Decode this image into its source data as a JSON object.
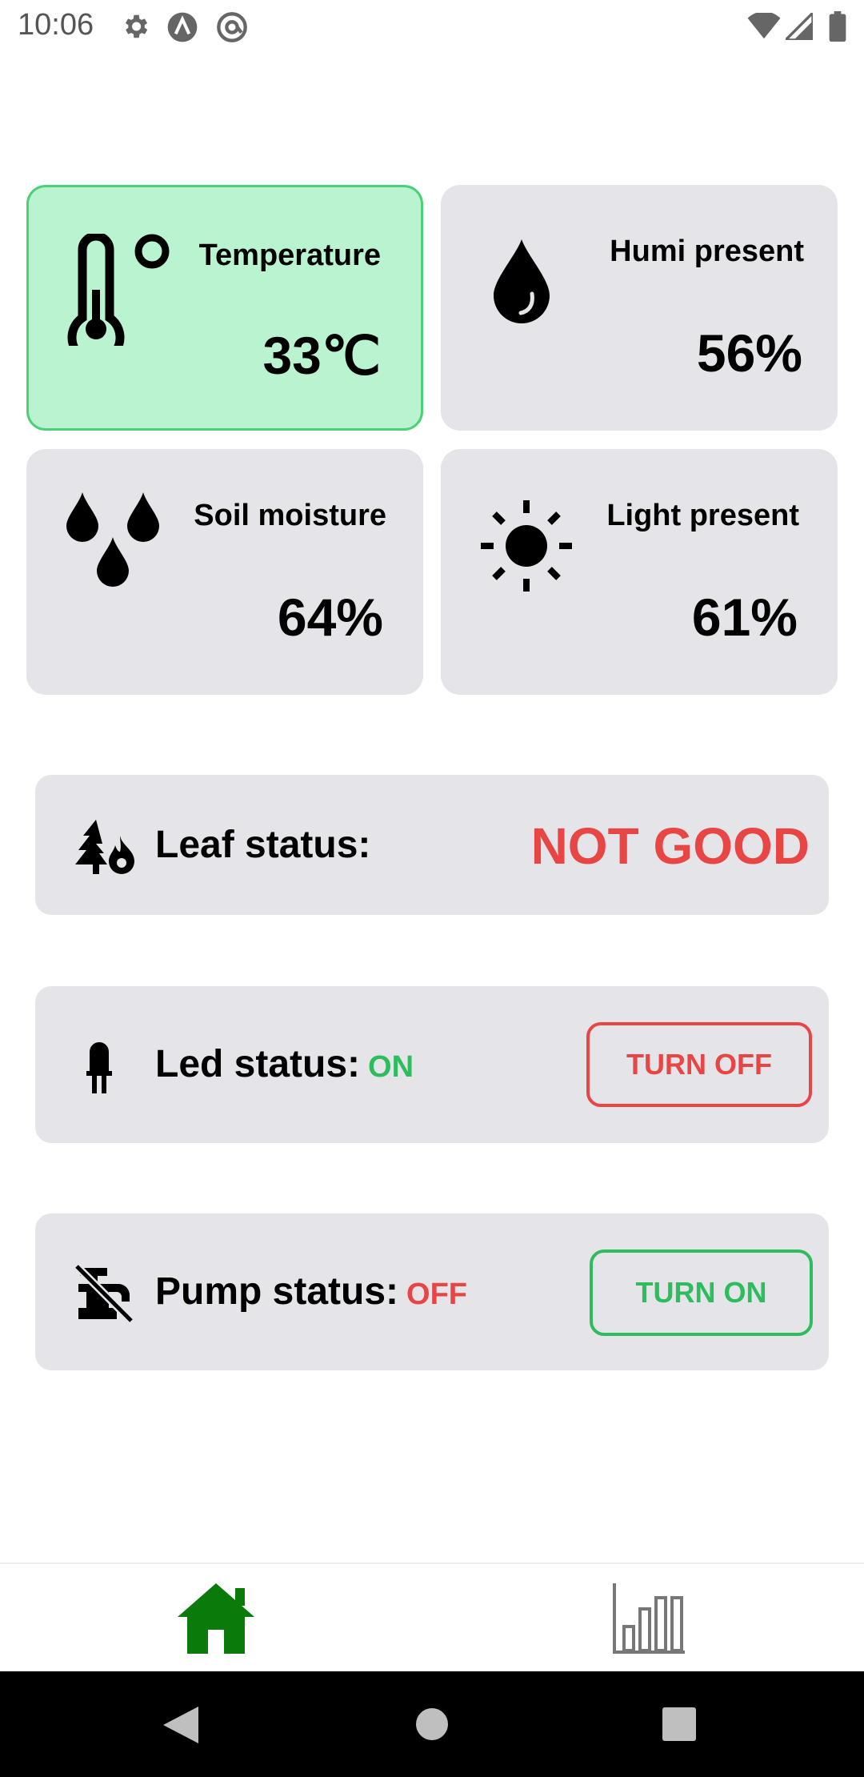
{
  "status_bar": {
    "time": "10:06",
    "icons": [
      "settings-icon",
      "a-logo-icon",
      "at-sync-icon",
      "wifi-icon",
      "cellular-icon",
      "battery-icon"
    ]
  },
  "sensors": [
    {
      "title": "Temperature",
      "value": "33℃",
      "icon": "thermometer-icon",
      "active": true
    },
    {
      "title": "Humi present",
      "value": "56%",
      "icon": "water-drop-icon",
      "active": false
    },
    {
      "title": "Soil moisture",
      "value": "64%",
      "icon": "water-drops-icon",
      "active": false
    },
    {
      "title": "Light present",
      "value": "61%",
      "icon": "sun-icon",
      "active": false
    }
  ],
  "leaf": {
    "label": "Leaf status:",
    "value": "NOT GOOD",
    "icon": "tree-fire-icon"
  },
  "led": {
    "label": "Led status:",
    "state": "ON",
    "button": "TURN OFF",
    "icon": "led-icon"
  },
  "pump": {
    "label": "Pump status:",
    "state": "OFF",
    "button": "TURN ON",
    "icon": "pump-off-icon"
  },
  "bottom_nav": {
    "items": [
      "home-icon",
      "bar-chart-icon"
    ],
    "active": "home-icon"
  },
  "colors": {
    "active_card_bg": "#b9f3d0",
    "active_card_border": "#4cd077",
    "card_bg": "#e5e5e9",
    "alert_red": "#e84545",
    "ok_green": "#2dbd5d",
    "nav_active": "#0a7a0a",
    "nav_inactive": "#777777"
  }
}
